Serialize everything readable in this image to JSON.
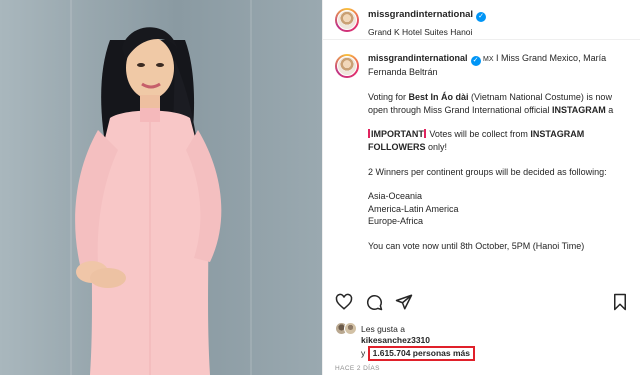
{
  "post": {
    "author": "missgrandinternational",
    "location": "Grand K Hotel Suites Hanoi",
    "caption": {
      "author": "missgrandinternational",
      "intro_flag": "MX",
      "intro": " I Miss Grand Mexico, María",
      "intro2": "Fernanda Beltrán",
      "vote_pre": "Voting for ",
      "vote_bold": "Best In Áo dài",
      "vote_post": " (Vietnam National Costume) is now",
      "vote2_pre": "open through Miss Grand International official ",
      "vote2_bold": "INSTAGRAM",
      "vote2_post": " a",
      "important_bold": "IMPORTANT",
      "important_post": " Votes will be collect from ",
      "important_bold2": "INSTAGRAM",
      "followers_bold": "FOLLOWERS",
      "followers_post": " only!",
      "winners": "2 Winners per continent groups will be decided as following:",
      "groups": [
        "Asia-Oceania",
        "America-Latin America",
        "Europe-Africa"
      ],
      "deadline": "You can vote now until 8th October, 5PM (Hanoi Time)"
    },
    "likes": {
      "prefix": "Les gusta a",
      "user": "kikesanchez3310",
      "y": "y",
      "count_text": "1.615.704 personas más"
    },
    "date": "HACE 2 DÍAS"
  },
  "colors": {
    "accent": "#0095f6",
    "highlight_border": "#e0202a",
    "dress": "#f8c7c7"
  }
}
